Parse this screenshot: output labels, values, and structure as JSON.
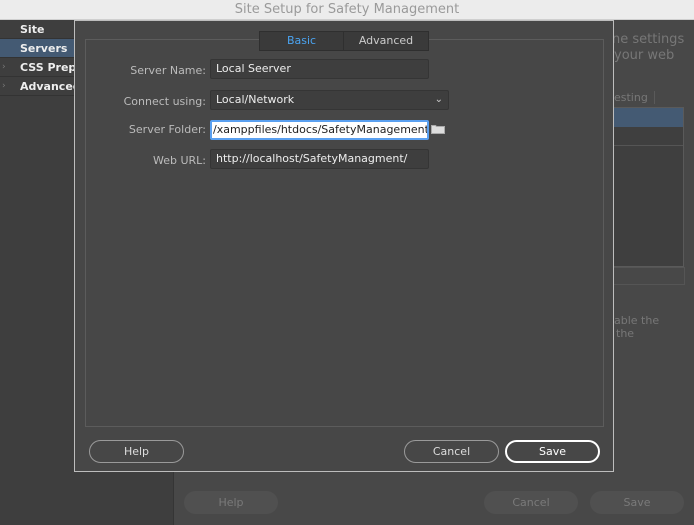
{
  "window": {
    "title": "Site Setup for Safety Management"
  },
  "sidebar": {
    "items": [
      {
        "label": "Site",
        "selected": false
      },
      {
        "label": "Servers",
        "selected": true
      },
      {
        "label": "CSS Preprocessors",
        "selected": false
      },
      {
        "label": "Advanced Settings",
        "selected": false
      }
    ]
  },
  "background": {
    "text1": "ne settings",
    "text2": "your web",
    "tab": "esting",
    "text3": "able the",
    "text4": "the",
    "help": "Help",
    "cancel": "Cancel",
    "save": "Save"
  },
  "dialog": {
    "tabs": [
      {
        "label": "Basic",
        "active": true
      },
      {
        "label": "Advanced",
        "active": false
      }
    ],
    "fields": {
      "server_name": {
        "label": "Server Name:",
        "value": "Local Seerver"
      },
      "connect_using": {
        "label": "Connect using:",
        "value": "Local/Network"
      },
      "server_folder": {
        "label": "Server Folder:",
        "value": "/xamppfiles/htdocs/SafetyManagement"
      },
      "web_url": {
        "label": "Web URL:",
        "value": "http://localhost/SafetyManagment/"
      }
    },
    "help": "Help",
    "cancel": "Cancel",
    "save": "Save"
  },
  "colors": {
    "selection": "#445a73",
    "active_tab": "#4aa3f0"
  }
}
